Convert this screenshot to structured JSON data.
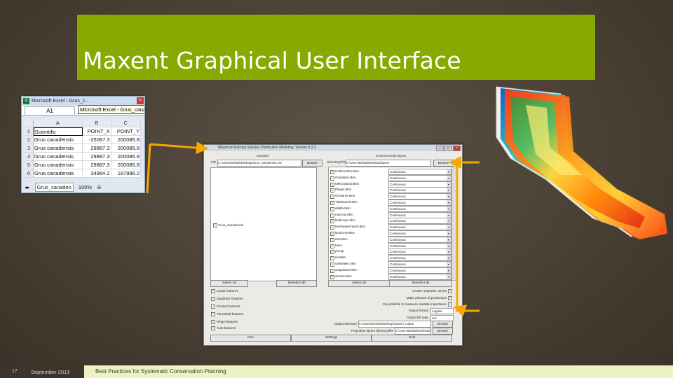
{
  "slide": {
    "title": "Maxent Graphical User Interface",
    "footer": {
      "number": "17",
      "date": "September 2013",
      "text": "Best Practices for Systematic Conservation Planning"
    }
  },
  "colors": {
    "title_bar": "#8aa900",
    "footer_band": "#eef2c2",
    "arrow": "#f5a800",
    "background": "#4a4034"
  },
  "excel": {
    "title": "Microsoft Excel - Grus_c...",
    "name_box": "A1",
    "tooltip": "Microsoft Excel - Grus_canad",
    "columns": [
      "A",
      "B",
      "C"
    ],
    "rows": [
      {
        "num": "1",
        "a": "Scientific",
        "b": "POINT_X",
        "c": "POINT_Y"
      },
      {
        "num": "2",
        "a": "Grus canadensis",
        "b": "-25087.3",
        "c": "200085.8"
      },
      {
        "num": "3",
        "a": "Grus canadensis",
        "b": "29887.3",
        "c": "200085.8"
      },
      {
        "num": "4",
        "a": "Grus canadensis",
        "b": "29887.3",
        "c": "200085.8"
      },
      {
        "num": "5",
        "a": "Grus canadensis",
        "b": "29887.3",
        "c": "200085.8"
      },
      {
        "num": "6",
        "a": "Grus canadensis",
        "b": "34964.2",
        "c": "187896.2"
      }
    ],
    "sheet_tab": "Grus_canaden",
    "zoom": "100%"
  },
  "maxent": {
    "title": "Maximum Entropy Species Distribution Modeling, Version 3.3.3",
    "samples_header": "Samples",
    "env_header": "Environmental layers",
    "file_label": "File",
    "file_path": "C:\\Users\\Default\\Desktop\\Grus_canadensis.csv",
    "dir_label": "Directory/File",
    "dir_path": "C:\\Users\\Default\\Desktop\\layers",
    "browse": "Browse",
    "species": "Grus_canadensis",
    "layers": [
      {
        "name": "Coldmonths.5km",
        "type": "Continuous"
      },
      {
        "name": "Grainland.5km",
        "type": "Continuous"
      },
      {
        "name": "Idlecropland.5km",
        "type": "Continuous"
      },
      {
        "name": "Playas.5km",
        "type": "Continuous"
      },
      {
        "name": "Orchards.5km",
        "type": "Continuous"
      },
      {
        "name": "Tidalmarsh.5km",
        "type": "Continuous"
      },
      {
        "name": "alfalfa.5km",
        "type": "Continuous"
      },
      {
        "name": "rowcrop.5km",
        "type": "Continuous"
      },
      {
        "name": "fieldcrops.5km",
        "type": "Continuous"
      },
      {
        "name": "freshwatermarsh.5km",
        "type": "Continuous"
      },
      {
        "name": "landcover5km",
        "type": "Continuous"
      },
      {
        "name": "elev.5km",
        "type": "Continuous"
      },
      {
        "name": "trees",
        "type": "Continuous"
      },
      {
        "name": "precip",
        "type": "Continuous"
      },
      {
        "name": "rice5km",
        "type": "Continuous"
      },
      {
        "name": "salinelake.5km",
        "type": "Continuous"
      },
      {
        "name": "wetpasture.5km",
        "type": "Continuous"
      },
      {
        "name": "stream.5km",
        "type": "Continuous"
      }
    ],
    "select_all": "Select all",
    "deselect_all": "Deselect all",
    "features": [
      "Linear features",
      "Quadratic features",
      "Product features",
      "Threshold features",
      "Hinge features",
      "Auto features"
    ],
    "right_options": [
      "Create response curves",
      "Make pictures of predictions",
      "Do jackknife to measure variable importance"
    ],
    "output_format_label": "Output format",
    "output_format_value": "Logistic",
    "output_file_type_label": "Output file type",
    "output_file_type_value": "asc",
    "output_dir_label": "Output directory",
    "output_dir_path": "C:\\Users\\Default\\Desktop\\maxent_output",
    "projection_label": "Projection layers directory/file",
    "projection_path": "C:\\Users\\Default\\Desktop\\projection",
    "run": "Run",
    "settings": "Settings",
    "help": "Help"
  }
}
